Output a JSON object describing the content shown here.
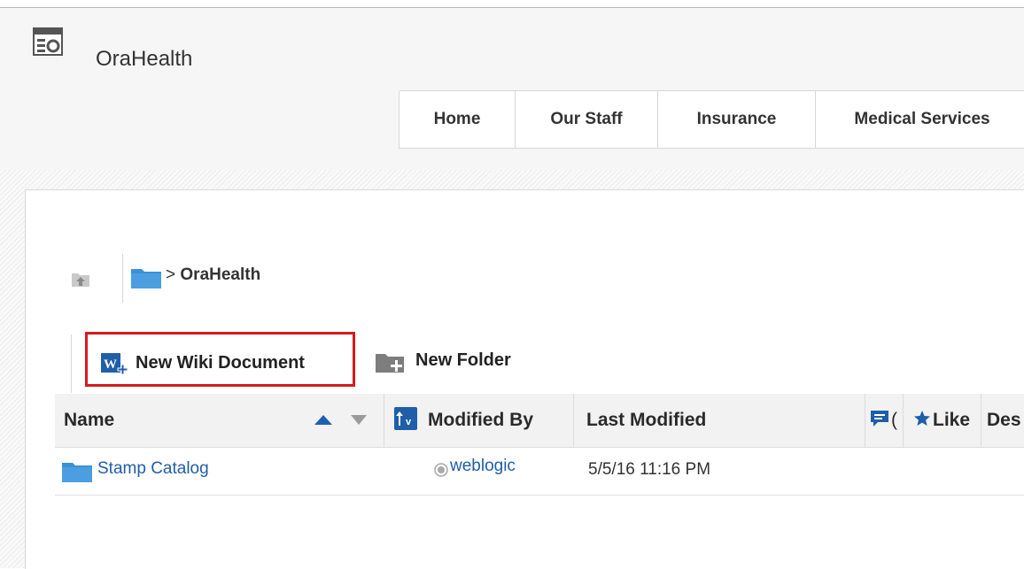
{
  "app": {
    "title": "OraHealth",
    "icon": "portal-app-icon"
  },
  "nav": {
    "tabs": [
      "Home",
      "Our Staff",
      "Insurance",
      "Medical Services"
    ]
  },
  "breadcrumb": {
    "separator": ">",
    "folder": "OraHealth"
  },
  "toolbar": {
    "new_wiki_label": "New Wiki Document",
    "new_folder_label": "New Folder",
    "highlight_color": "#d6191c"
  },
  "table": {
    "columns": {
      "name": "Name",
      "modified_by": "Modified By",
      "last_modified": "Last Modified",
      "comments_truncated": "(",
      "like": "Like",
      "description_truncated": "Des"
    },
    "rows": [
      {
        "name": "Stamp Catalog",
        "modified_by": "weblogic",
        "last_modified": "5/5/16 11:16 PM"
      }
    ]
  },
  "colors": {
    "link": "#1f5ea8",
    "folder": "#3d8fd6",
    "sort_active": "#1e5fb4"
  }
}
